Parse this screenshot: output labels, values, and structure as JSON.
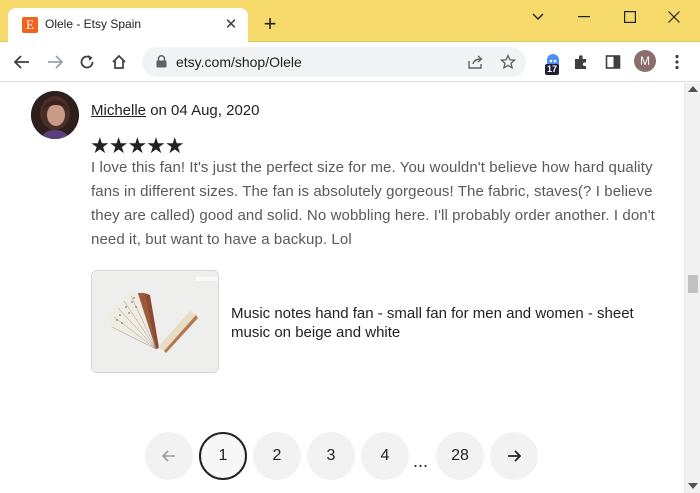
{
  "browser": {
    "tab_title": "Olele - Etsy Spain",
    "favicon_letter": "E",
    "url": "etsy.com/shop/Olele",
    "extension_badge": "17",
    "profile_initial": "M"
  },
  "review": {
    "reviewer_name": "Michelle",
    "date_text": " on 04 Aug, 2020",
    "rating": 5,
    "stars": "★★★★★",
    "text": "I love this fan! It's just the perfect size for me. You wouldn't believe how hard quality fans in different sizes. The fan is absolutely gorgeous! The fabric, staves(? I believe they are called) good and solid. No wobbling here. I'll probably order another. I don't need it, but want to have a backup. Lol",
    "product_title": "Music notes hand fan - small fan for men and women - sheet music on beige and white"
  },
  "pagination": {
    "pages": [
      "1",
      "2",
      "3",
      "4",
      "28"
    ],
    "current": "1",
    "ellipsis": "..."
  },
  "colors": {
    "titlebar": "#f6db6c",
    "etsy_orange": "#f1641e"
  }
}
